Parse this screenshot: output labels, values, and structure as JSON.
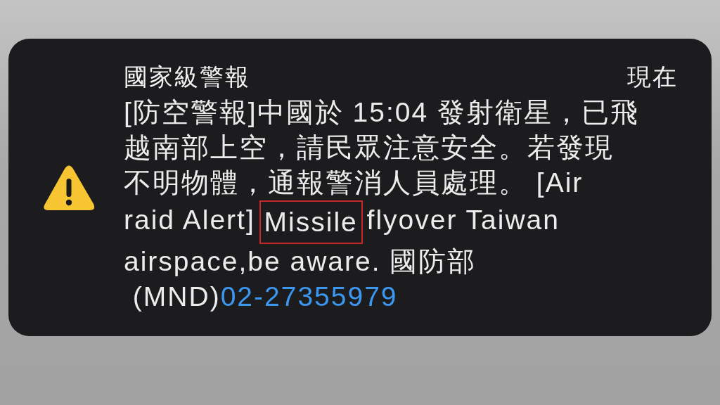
{
  "notification": {
    "title": "國家級警報",
    "time": "現在",
    "body_lines": [
      [
        {
          "kind": "text",
          "text": "[防空警報]中國於 15:04 發射衛星，已飛"
        }
      ],
      [
        {
          "kind": "text",
          "text": "越南部上空，請民眾注意安全。若發現"
        }
      ],
      [
        {
          "kind": "text",
          "text": "不明物體，通報警消人員處理。 [Air"
        }
      ],
      [
        {
          "kind": "text",
          "text": "raid Alert] "
        },
        {
          "kind": "highlight",
          "text": "Missile"
        },
        {
          "kind": "text",
          "text": " flyover Taiwan"
        }
      ],
      [
        {
          "kind": "text",
          "text": "airspace,be aware. 國防部"
        }
      ],
      [
        {
          "kind": "text",
          "text": " (MND)"
        },
        {
          "kind": "link",
          "text": "02-27355979"
        }
      ]
    ]
  }
}
